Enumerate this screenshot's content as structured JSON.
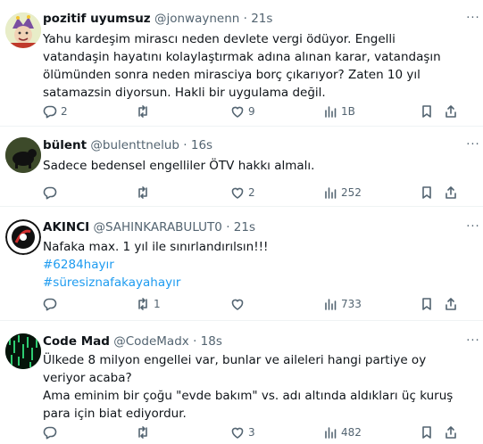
{
  "tweets": [
    {
      "name": "pozitif uyumsuz",
      "handle": "@jonwaynenn",
      "dot": "·",
      "time": "21s",
      "lines": [
        "Yahu kardeşim mirascı neden devlete vergi ödüyor. Engelli vatandaşin hayatını kolaylaştırmak adına alınan karar, vatandaşın ölümünden sonra neden mirasciya borç çıkarıyor? Zaten 10 yıl satamazsin diyorsun. Hakli bir uygulama değil."
      ],
      "replies": "2",
      "reposts": "",
      "likes": "9",
      "views": "1B"
    },
    {
      "name": "bülent",
      "handle": "@bulenttnelub",
      "dot": "·",
      "time": "16s",
      "lines": [
        "Sadece bedensel engelliler ÖTV hakkı almalı."
      ],
      "replies": "",
      "reposts": "",
      "likes": "2",
      "views": "252"
    },
    {
      "name": "AKINCI",
      "handle": "@SAHINKARABULUT0",
      "dot": "·",
      "time": "21s",
      "lines": [
        "Nafaka max. 1 yıl ile sınırlandırılsın!!!"
      ],
      "hashtags": [
        "#6284hayır",
        "#süresiznafakayahayır"
      ],
      "replies": "",
      "reposts": "1",
      "likes": "",
      "views": "733"
    },
    {
      "name": "Code Mad",
      "handle": "@CodeMadx",
      "dot": "·",
      "time": "18s",
      "lines": [
        "Ülkede 8 milyon engellei var, bunlar ve aileleri hangi partiye oy veriyor acaba?",
        "Ama eminim bir çoğu \"evde bakım\" vs. adı altında aldıkları üç kuruş para için biat ediyordur."
      ],
      "replies": "",
      "reposts": "",
      "likes": "3",
      "views": "482"
    }
  ],
  "icons": {
    "reply": "speech-bubble-icon",
    "repost": "repost-arrows-icon",
    "like": "heart-icon",
    "views": "bar-chart-icon",
    "bookmark": "bookmark-icon",
    "share": "share-icon",
    "more": "more-dots-icon"
  },
  "colors": {
    "link": "#1d9bf0",
    "muted": "#536471",
    "text": "#0f1419",
    "divider": "#eff3f4"
  }
}
